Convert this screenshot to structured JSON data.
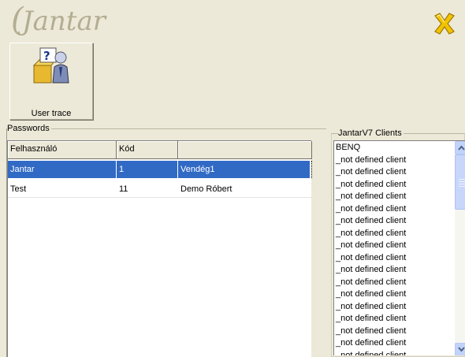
{
  "header": {
    "logo_text": "Jantar",
    "close_icon": "x-close-icon"
  },
  "toolbar": {
    "user_trace_label": "User trace",
    "user_trace_icon": "help-user-icon"
  },
  "passwords": {
    "legend": "Passwords",
    "columns": [
      "Felhasználó",
      "Kód",
      ""
    ],
    "rows": [
      {
        "user": "Jantar",
        "code": "1",
        "name": "Vendég1",
        "selected": true
      },
      {
        "user": "Test",
        "code": "11",
        "name": "Demo Róbert",
        "selected": false
      }
    ]
  },
  "clients": {
    "legend": "JantarV7 Clients",
    "items": [
      "BENQ",
      "_not defined client",
      "_not defined client",
      "_not defined client",
      "_not defined client",
      "_not defined client",
      "_not defined client",
      "_not defined client",
      "_not defined client",
      "_not defined client",
      "_not defined client",
      "_not defined client",
      "_not defined client",
      "_not defined client",
      "_not defined client",
      "_not defined client",
      "_not defined client",
      "_not defined client"
    ]
  },
  "colors": {
    "selection": "#316ac5",
    "window_bg": "#ece9d8",
    "logo": "#b3ad93",
    "close_icon_yellow": "#f2c400"
  }
}
